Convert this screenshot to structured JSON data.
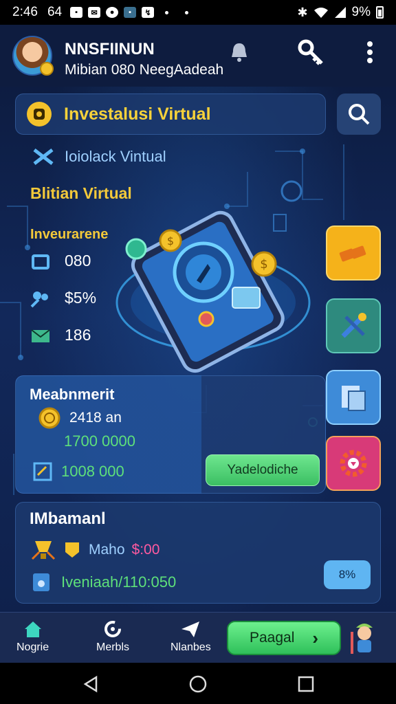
{
  "status_bar": {
    "time": "2:46",
    "time_extra": "64",
    "battery": "9%"
  },
  "header": {
    "title": "NNSFIINUN",
    "subtitle": "Mibian 080 NeegAadeah"
  },
  "title_card": {
    "title": "Investalusi Virtual"
  },
  "main": {
    "subtitle_row": "Ioiolack Vintual",
    "section_title": "Blitian Virtual",
    "stats_title": "Inveurarene",
    "stats": [
      {
        "value": "080",
        "icon": "wallet-icon"
      },
      {
        "value": "$5%",
        "icon": "users-icon"
      },
      {
        "value": "186",
        "icon": "mail-icon"
      }
    ]
  },
  "side_tiles": [
    {
      "icon": "gold-bars-icon",
      "color": "#f5b21a"
    },
    {
      "icon": "tools-icon",
      "color": "#2e8a7e"
    },
    {
      "icon": "document-icon",
      "color": "#3e8bd8"
    },
    {
      "icon": "settings-icon",
      "color": "#d83a78"
    }
  ],
  "measurement": {
    "title": "Meabnmerit",
    "line1": "2418 an",
    "line2": "1700 0000",
    "line3": "1008 000",
    "button": "Yadelodiche"
  },
  "info_card": {
    "title": "IMbamanl",
    "row1_label": "Maho",
    "row1_value": "$:00",
    "row2": "Iveniaah/110:050",
    "badge": "8%"
  },
  "bottom_nav": {
    "items": [
      {
        "label": "Nogrie",
        "icon": "home-icon"
      },
      {
        "label": "Merbls",
        "icon": "refresh-icon"
      },
      {
        "label": "Nlanbes",
        "icon": "send-icon"
      }
    ],
    "cta": "Paagal",
    "cta_arrow": "›"
  },
  "colors": {
    "accent_yellow": "#f3c93a",
    "accent_green": "#5ee07a",
    "background": "#12285a"
  }
}
